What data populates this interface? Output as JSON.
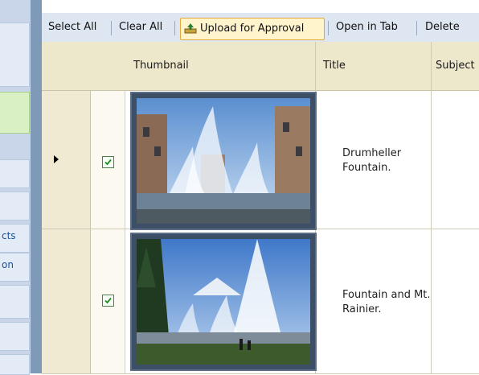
{
  "toolbar": {
    "select_all": "Select All",
    "clear_all": "Clear All",
    "upload_for_approval": "Upload for Approval",
    "open_in_tab": "Open in Tab",
    "delete": "Delete"
  },
  "nav": {
    "item_cts": "cts",
    "item_on": "on"
  },
  "grid": {
    "columns": [
      "Thumbnail",
      "Title",
      "Subject"
    ],
    "rows": [
      {
        "title_line1": "Drumheller",
        "title_line2": "Fountain.",
        "checked": true,
        "current": true,
        "thumbnail_icon": "fountain-photo"
      },
      {
        "title_line1": "Fountain and Mt.",
        "title_line2": "Rainier.",
        "checked": true,
        "current": false,
        "thumbnail_icon": "fountain-mountain-photo"
      }
    ]
  },
  "colors": {
    "toolbar_bg": "#dee6f2",
    "header_bg": "#ede7cc",
    "upload_highlight": "#fff4cc",
    "checkbox_border": "#4f7f4f"
  }
}
